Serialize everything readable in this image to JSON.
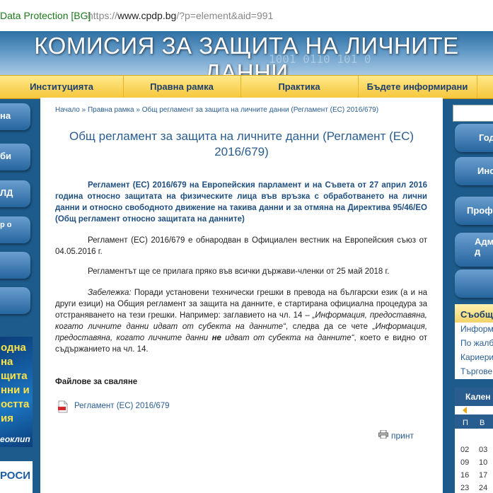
{
  "address_bar": {
    "site_identity": "Data Protection [BG]",
    "url_prefix": "https://",
    "url_domain": "www.cpdp.bg",
    "url_path": "/?p=element&aid=991"
  },
  "banner": {
    "title": "КОМИСИЯ ЗА ЗАЩИТА НА ЛИЧНИТЕ ДАННИ",
    "background_digits": "1001 0110 101 0"
  },
  "nav": {
    "items": [
      "Институцията",
      "Правна рамка",
      "Практика",
      "Бъдете информирани"
    ]
  },
  "left_sidebar": {
    "buttons": [
      "на",
      "би",
      "ЛД",
      "р о",
      "",
      ""
    ],
    "promo1_text": "одна на щита нни и остта ия",
    "promo1_sub": "еоклип",
    "promo2_text": "РОСИ"
  },
  "breadcrumb": {
    "home": "Начало",
    "sep1": "»",
    "section": "Правна рамка",
    "sep2": "»",
    "current": "Общ регламент за защита на личните данни (Регламент (ЕС) 2016/679)"
  },
  "article": {
    "title": "Общ регламент за защита на личните данни (Регламент (ЕС) 2016/679)",
    "lead": "Регламент (ЕС) 2016/679 на Европейския парламент и на Съвета от 27 април 2016 година относно защитата на физическите лица във връзка с обработването на лични данни и относно свободното движение на такива данни и за отмяна на Директива 95/46/ЕО (Общ регламент относно защитата на данните)",
    "para1": "Регламент (ЕС) 2016/679 е обнародван в Официален вестник на Европейския съюз от 04.05.2016 г.",
    "para2": "Регламентът ще се прилага пряко във всички държави-членки от 25 май 2018 г.",
    "note_label": "Забележка:",
    "note_text1": " Поради установени технически грешки в превода на български език (а и на други езици) на Общия регламент за защита на данните, е стартирана официална процедура за отстраняването на тези грешки. Например: заглавието на чл. 14 – ",
    "note_q1": "„Информация, предоставяна, когато личните данни идват от субекта на данните“",
    "note_text2": ", следва да се чете ",
    "note_q2a": "„Информация, предоставяна, когато личните данни ",
    "note_q2_bold": "не",
    "note_q2b": " идват от субекта на данните“",
    "note_text3": ", което е видно от съдържанието на чл. 14.",
    "files_heading": "Файлове за сваляне",
    "file_link": "Регламент (ЕС) 2016/679",
    "print_label": "принт"
  },
  "right_sidebar": {
    "search_placeholder": "",
    "buttons": [
      "Год",
      "Инс",
      "Проф",
      "Адм д",
      ""
    ],
    "messages_heading": "Съобщ",
    "messages_items": [
      "Информ",
      "По жалб",
      "Кариери",
      "Търгове"
    ],
    "calendar_heading": "Кален",
    "calendar_dayheaders": [
      "П",
      "В"
    ],
    "calendar_days": [
      "02",
      "03",
      "09",
      "10",
      "16",
      "17",
      "23",
      "24"
    ]
  },
  "colors": {
    "brand_blue": "#2a5d8f",
    "nav_yellow": "#f5c63a",
    "page_bg": "#1d5b8c"
  }
}
